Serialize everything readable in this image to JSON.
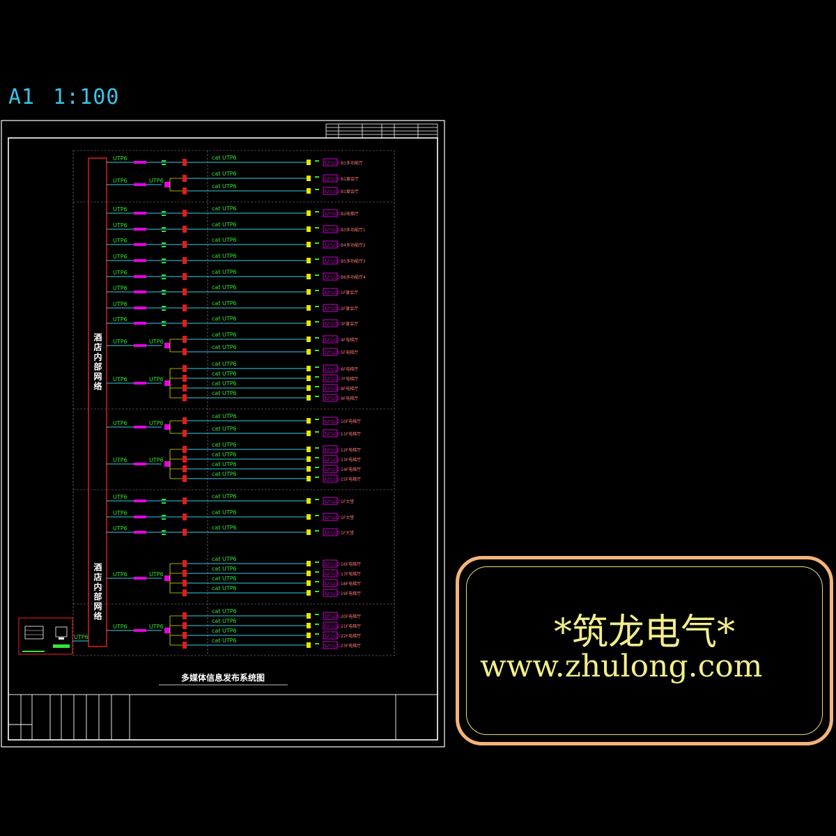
{
  "scale": {
    "sheet": "A1",
    "ratio": "1:100"
  },
  "diagram": {
    "title": "多媒体信息发布系统图",
    "backbone_label_top": "酒店内部网络",
    "backbone_label_bottom": "酒店内部网络",
    "cable_short": "UTP6",
    "cable_long": "cat UTP6",
    "terminal_label": "32\"LCD",
    "colors": {
      "frame": "#ffffff",
      "backbone": "#d21c1c",
      "cyan": "#35d2e6",
      "yellow": "#e6e600",
      "magenta": "#e600e6",
      "green": "#34e634",
      "red": "#e61a1a",
      "pink": "#ff7a7a",
      "grid": "#8a8a8a"
    },
    "rows": [
      {
        "group": "single",
        "location": "B1多功能厅"
      },
      {
        "group": "pair",
        "location": "B1宴会厅"
      },
      {
        "group": "pair",
        "location": "B1宴会厅"
      },
      {
        "group": "single",
        "location": "B2电梯厅"
      },
      {
        "group": "single",
        "location": "B3多功能厅1"
      },
      {
        "group": "single",
        "location": "B4多功能厅2"
      },
      {
        "group": "single",
        "location": "B5多功能厅3"
      },
      {
        "group": "single",
        "location": "B6多功能厅4"
      },
      {
        "group": "single",
        "location": "1F宴会厅"
      },
      {
        "group": "single",
        "location": "2F宴会厅"
      },
      {
        "group": "single",
        "location": "3F宴会厅"
      },
      {
        "group": "pair",
        "location": "4F电梯厅"
      },
      {
        "group": "pair",
        "location": "5F电梯厅"
      },
      {
        "group": "quad",
        "location": "6F电梯厅"
      },
      {
        "group": "quad",
        "location": "7F电梯厅"
      },
      {
        "group": "quad",
        "location": "8F电梯厅"
      },
      {
        "group": "quad",
        "location": "9F电梯厅"
      },
      {
        "group": "pair",
        "location": "10F电梯厅"
      },
      {
        "group": "pair",
        "location": "11F电梯厅"
      },
      {
        "group": "quad",
        "location": "12F电梯厅"
      },
      {
        "group": "quad",
        "location": "13F电梯厅"
      },
      {
        "group": "quad",
        "location": "14F电梯厅"
      },
      {
        "group": "quad",
        "location": "15F电梯厅"
      },
      {
        "group": "single",
        "location": "1F大堂"
      },
      {
        "group": "single",
        "location": "1F大堂"
      },
      {
        "group": "single",
        "location": "1F大堂"
      },
      {
        "group": "quad",
        "location": "16F电梯厅"
      },
      {
        "group": "quad",
        "location": "17F电梯厅"
      },
      {
        "group": "quad",
        "location": "18F电梯厅"
      },
      {
        "group": "quad",
        "location": "19F电梯厅"
      },
      {
        "group": "quad",
        "location": "20F电梯厅"
      },
      {
        "group": "quad",
        "location": "21F电梯厅"
      },
      {
        "group": "quad",
        "location": "22F电梯厅"
      },
      {
        "group": "quad",
        "location": "23F电梯厅"
      }
    ]
  },
  "watermark": {
    "title": "*筑龙电气*",
    "url": "www.zhulong.com"
  }
}
